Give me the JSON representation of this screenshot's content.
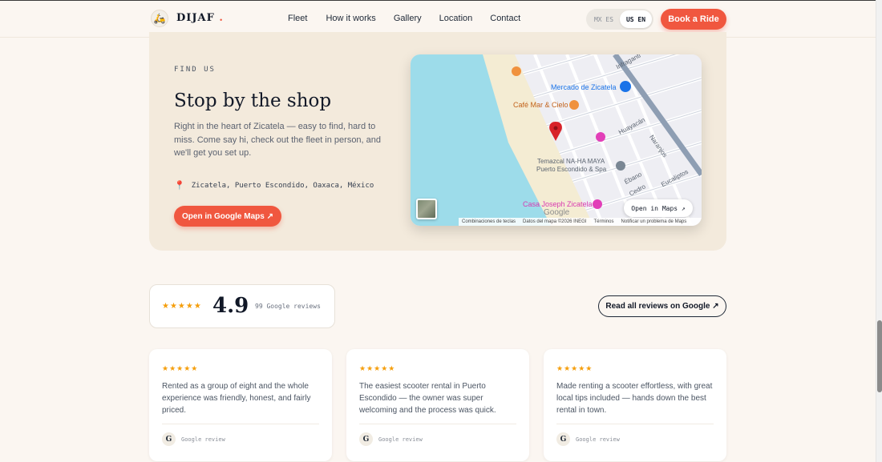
{
  "header": {
    "brand": "DIJAF",
    "brand_dot": ".",
    "nav": [
      "Fleet",
      "How it works",
      "Gallery",
      "Location",
      "Contact"
    ],
    "lang": {
      "mx": "MX ES",
      "us": "US EN",
      "active": "us"
    },
    "book_label": "Book a Ride"
  },
  "find": {
    "eyebrow": "FIND US",
    "title": "Stop by the shop",
    "description": "Right in the heart of Zicatela — easy to find, hard to miss. Come say hi, check out the fleet in person, and we'll get you set up.",
    "address": "Zicatela, Puerto Escondido, Oaxaca, México",
    "maps_button": "Open in Google Maps ↗"
  },
  "map": {
    "labels": {
      "mercado": "Mercado de Zicatela",
      "cafe": "Café Mar & Cielo",
      "temazcal_1": "Temazcal NA-HA MAYA",
      "temazcal_2": "Puerto Escondido & Spa",
      "casa": "Casa Joseph Zicatela",
      "google": "Google",
      "street_infraganti": "Infraganti",
      "street_huayacan": "Huayacán",
      "street_naranjos": "Naranjos",
      "street_ebano": "Ébano",
      "street_cedro": "Cedro",
      "street_eucaliptos": "Eucaliptos"
    },
    "open_label": "Open in Maps ↗",
    "footer": [
      "Combinaciones de teclas",
      "Datos del mapa ©2026 INEGI",
      "Términos",
      "Notificar un problema de Maps"
    ],
    "colors": {
      "water": "#9ddcea",
      "sand": "#f4ecd3",
      "land": "#eeeef3",
      "highway": "#8e9eb3",
      "pin": "#d8232a"
    }
  },
  "rating": {
    "stars": "★★★★★",
    "value": "4.9",
    "count": "99 Google reviews",
    "read_all": "Read all reviews on Google ↗"
  },
  "reviews": [
    {
      "stars": "★★★★★",
      "text": "Rented as a group of eight and the whole experience was friendly, honest, and fairly priced.",
      "badge": "G",
      "source": "Google review"
    },
    {
      "stars": "★★★★★",
      "text": "The easiest scooter rental in Puerto Escondido — the owner was super welcoming and the process was quick.",
      "badge": "G",
      "source": "Google review"
    },
    {
      "stars": "★★★★★",
      "text": "Made renting a scooter effortless, with great local tips included — hands down the best rental in town.",
      "badge": "G",
      "source": "Google review"
    }
  ],
  "colors": {
    "accent": "#f0573f",
    "page_bg": "#fbf6f1",
    "card_bg": "#f3eadc",
    "star": "#f59e0b"
  }
}
